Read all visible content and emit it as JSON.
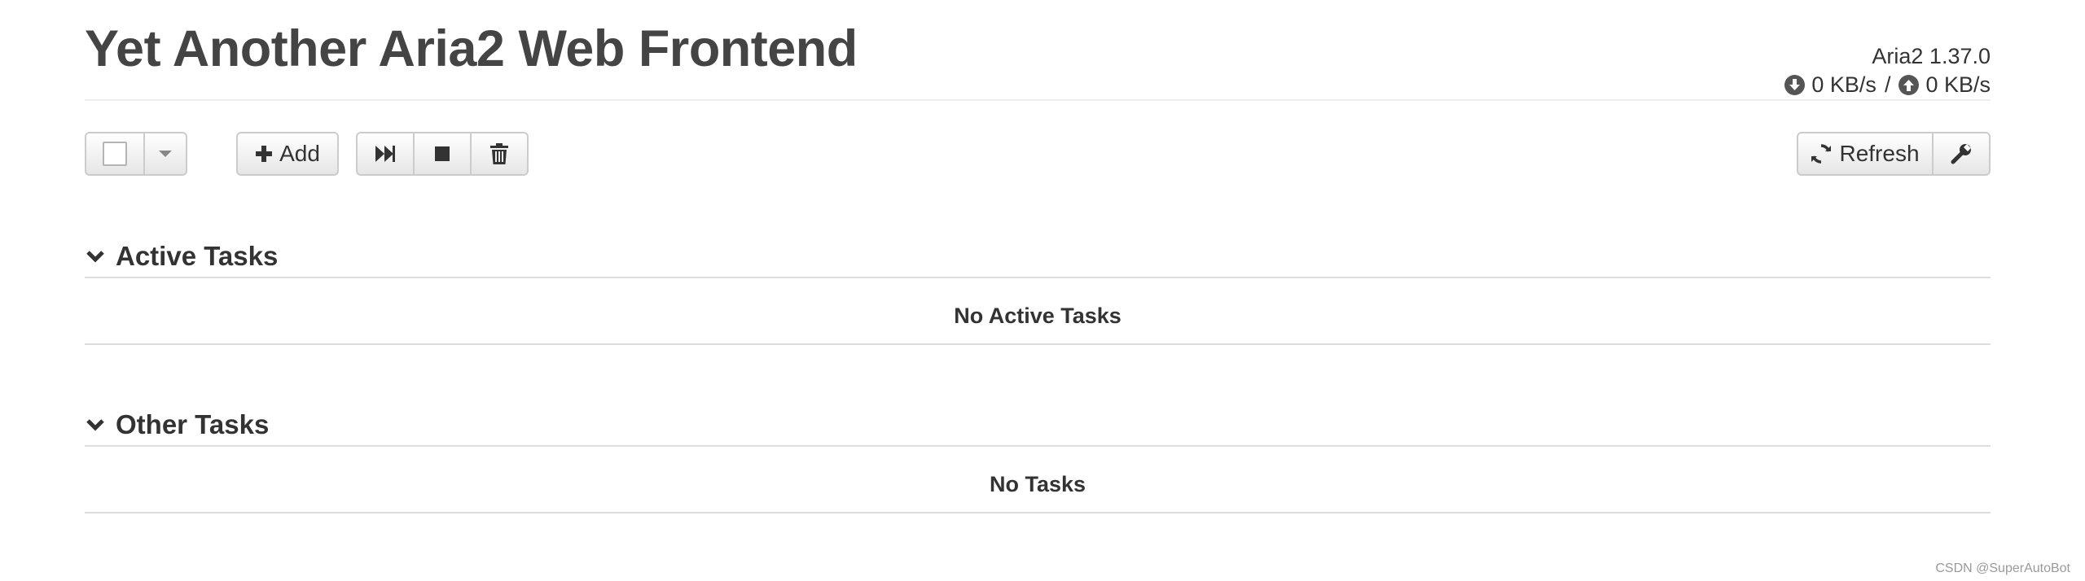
{
  "header": {
    "title": "Yet Another Aria2 Web Frontend",
    "version": "Aria2 1.37.0",
    "download_speed": "0 KB/s",
    "separator": "/",
    "upload_speed": "0 KB/s"
  },
  "toolbar": {
    "add_label": "Add",
    "refresh_label": "Refresh"
  },
  "sections": {
    "active": {
      "title": "Active Tasks",
      "empty_text": "No Active Tasks"
    },
    "other": {
      "title": "Other Tasks",
      "empty_text": "No Tasks"
    }
  },
  "icons": {
    "download": "download-circle-icon",
    "upload": "upload-circle-icon",
    "add": "plus-icon",
    "resume": "fast-forward-icon",
    "stop": "stop-icon",
    "delete": "trash-icon",
    "refresh": "refresh-icon",
    "settings": "wrench-icon",
    "collapse": "chevron-down-icon"
  },
  "watermark": "CSDN @SuperAutoBot"
}
